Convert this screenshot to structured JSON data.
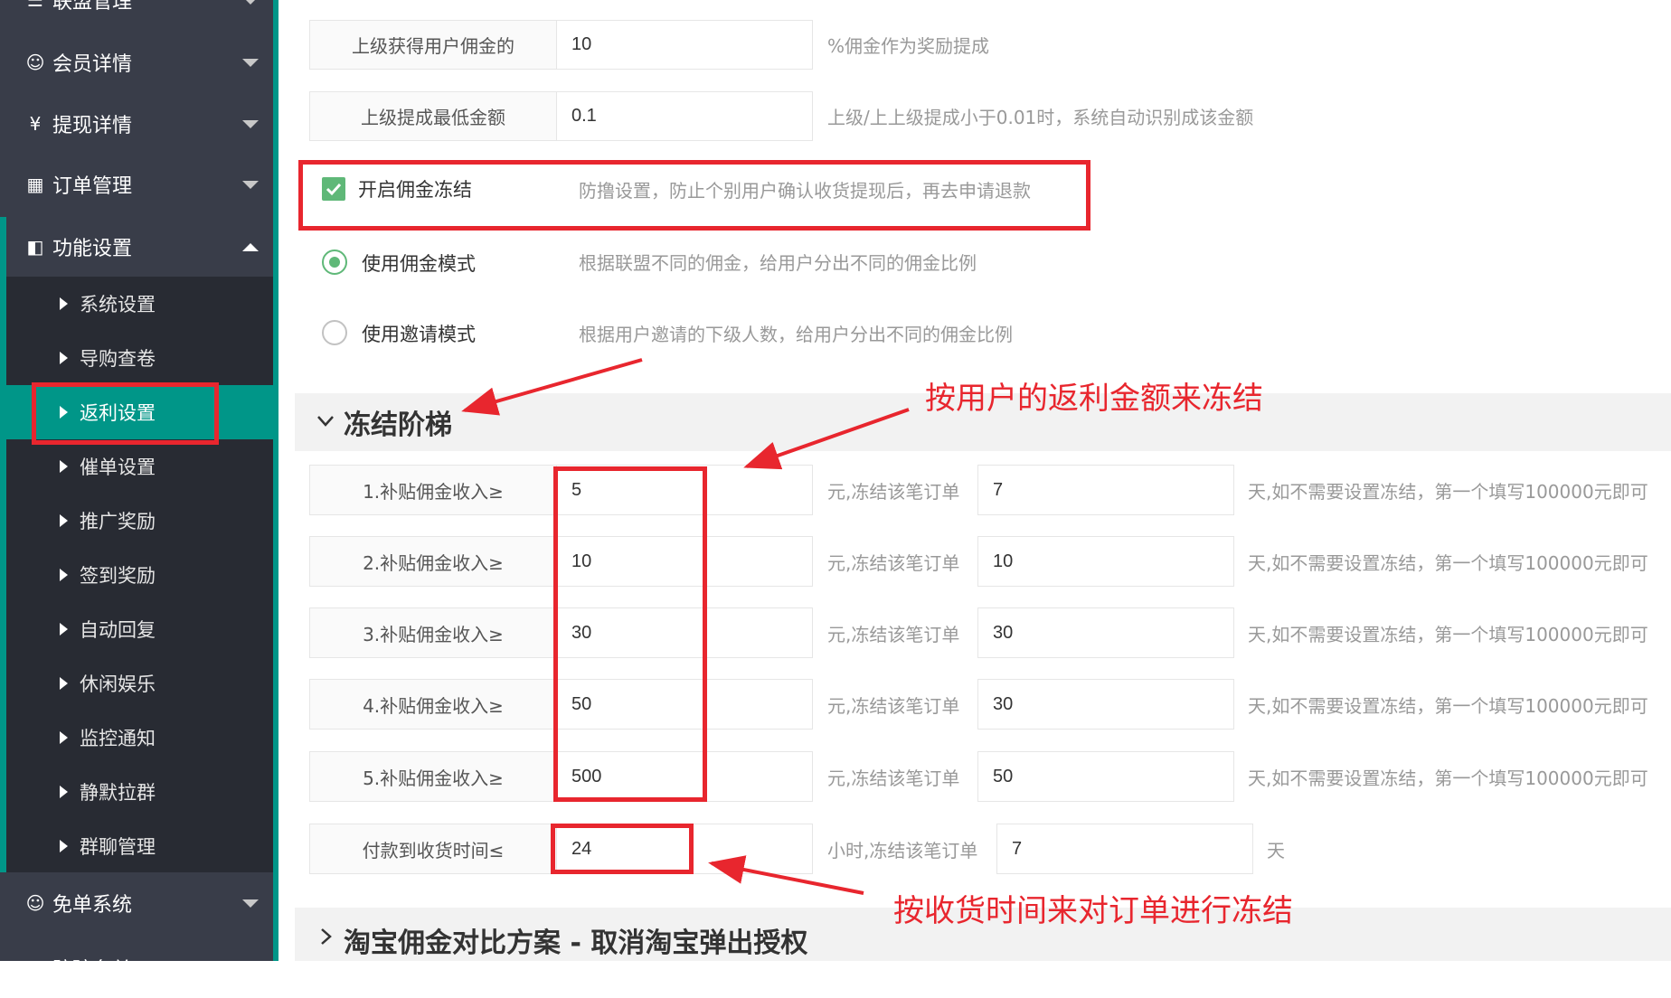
{
  "sidebar": {
    "top_item": "联盟管理",
    "items": [
      {
        "label": "会员详情",
        "icon": "user-icon"
      },
      {
        "label": "提现详情",
        "icon": "yen-icon"
      },
      {
        "label": "订单管理",
        "icon": "grid-icon"
      },
      {
        "label": "功能设置",
        "icon": "apps-icon"
      }
    ],
    "sub_items": [
      "系统设置",
      "导购查卷",
      "返利设置",
      "催单设置",
      "推广奖励",
      "签到奖励",
      "自动回复",
      "休闲娱乐",
      "监控通知",
      "静默拉群",
      "群聊管理"
    ],
    "active_sub_item": "返利设置",
    "bottom_item": {
      "label": "免单系统",
      "icon": "smile-icon"
    },
    "cut_item": "防骗名单"
  },
  "form": {
    "upline_commission": {
      "label": "上级获得用户佣金的",
      "value": "10",
      "suffix": "%佣金作为奖励提成"
    },
    "upline_min": {
      "label": "上级提成最低金额",
      "value": "0.1",
      "suffix": "上级/上上级提成小于0.01时，系统自动识别成该金额"
    },
    "freeze_toggle": {
      "label": "开启佣金冻结",
      "checked": true,
      "tip": "防撸设置，防止个别用户确认收货提现后，再去申请退款"
    },
    "mode_commission": {
      "label": "使用佣金模式",
      "selected": true,
      "tip": "根据联盟不同的佣金，给用户分出不同的佣金比例"
    },
    "mode_invite": {
      "label": "使用邀请模式",
      "selected": false,
      "tip": "根据用户邀请的下级人数，给用户分出不同的佣金比例"
    }
  },
  "freeze_section": {
    "title": "冻结阶梯",
    "tiers": [
      {
        "label": "1.补贴佣金收入≥",
        "amount": "5",
        "mid": "元,冻结该笔订单",
        "days": "7",
        "tail": "天,如不需要设置冻结，第一个填写100000元即可"
      },
      {
        "label": "2.补贴佣金收入≥",
        "amount": "10",
        "mid": "元,冻结该笔订单",
        "days": "10",
        "tail": "天,如不需要设置冻结，第一个填写100000元即可"
      },
      {
        "label": "3.补贴佣金收入≥",
        "amount": "30",
        "mid": "元,冻结该笔订单",
        "days": "30",
        "tail": "天,如不需要设置冻结，第一个填写100000元即可"
      },
      {
        "label": "4.补贴佣金收入≥",
        "amount": "50",
        "mid": "元,冻结该笔订单",
        "days": "30",
        "tail": "天,如不需要设置冻结，第一个填写100000元即可"
      },
      {
        "label": "5.补贴佣金收入≥",
        "amount": "500",
        "mid": "元,冻结该笔订单",
        "days": "50",
        "tail": "天,如不需要设置冻结，第一个填写100000元即可"
      }
    ],
    "receipt": {
      "label": "付款到收货时间≤",
      "hours": "24",
      "mid": "小时,冻结该笔订单",
      "days": "7",
      "tail": "天"
    }
  },
  "taobao_section": {
    "title": "淘宝佣金对比方案 - 取消淘宝弹出授权"
  },
  "annotations": {
    "amount_note": "按用户的返利金额来冻结",
    "time_note": "按收货时间来对订单进行冻结"
  },
  "colors": {
    "sidebar_bg": "#393d49",
    "submenu_bg": "#282b33",
    "accent": "#009688",
    "checkbox": "#5fb878",
    "annotation_red": "#e8262e"
  }
}
